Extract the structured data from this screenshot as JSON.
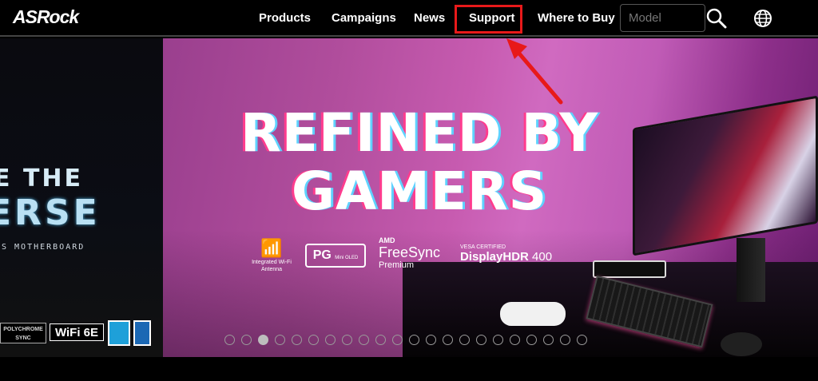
{
  "header": {
    "logo_text": "ASRock",
    "nav": [
      "Products",
      "Campaigns",
      "News",
      "Support",
      "Where to Buy"
    ],
    "search_placeholder": "Model",
    "search_icon": "search-icon",
    "language_icon": "globe-icon",
    "highlight_color": "#e8191a"
  },
  "left_slide": {
    "line1": "E THE",
    "line2": "ERSE",
    "line3": "S MOTHERBOARD",
    "badges": [
      "POLYCHROME SYNC",
      "WiFi 6E"
    ]
  },
  "hero": {
    "headline_line1": "REFINED BY",
    "headline_line2": "GAMERS",
    "features": {
      "wifi_label": "Integrated Wi-Fi Antenna",
      "pg_label": "PG",
      "pg_sub": "Mini OLED",
      "freesync_brand": "AMD",
      "freesync_title": "FreeSync",
      "freesync_tier": "Premium",
      "hdr_vesa": "VESA CERTIFIED",
      "hdr_title": "DisplayHDR",
      "hdr_level": "400"
    }
  },
  "carousel": {
    "dot_count": 22,
    "active_index": 2
  },
  "annotation": {
    "arrow_color": "#e8191a",
    "target": "Support"
  }
}
